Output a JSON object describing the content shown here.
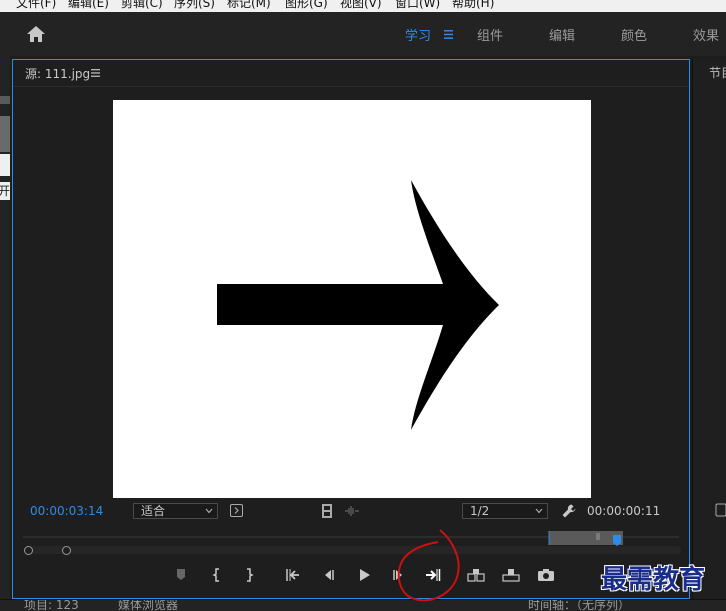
{
  "menu": [
    "文件(F)",
    "编辑(E)",
    "剪辑(C)",
    "序列(S)",
    "标记(M)",
    "图形(G)",
    "视图(V)",
    "窗口(W)",
    "帮助(H)"
  ],
  "workspaces": {
    "learn": "学习",
    "assembly": "组件",
    "editing": "编辑",
    "color": "颜色",
    "effects": "效果"
  },
  "left_strip_text": "开",
  "source_panel": {
    "title": "源: 111.jpg",
    "current_time": "00:00:03:14",
    "zoom": "适合",
    "resolution": "1/2",
    "duration": "00:00:00:11"
  },
  "right_panel": {
    "title": "节目"
  },
  "bottom_tabs": {
    "project": "项目: 123",
    "media_browser": "媒体浏览器",
    "timeline": "时间轴：（无序列）"
  },
  "watermark": "最需教育",
  "colors": {
    "accent": "#2d8ceb",
    "annotation": "#cc1111"
  },
  "icons": [
    "home-icon",
    "hamburger-icon",
    "add-marker-icon",
    "mark-in-icon",
    "mark-out-icon",
    "go-to-in-icon",
    "step-back-icon",
    "play-icon",
    "step-forward-icon",
    "go-to-out-icon",
    "insert-icon",
    "overwrite-icon",
    "export-frame-icon",
    "wrench-icon",
    "drag-video-icon",
    "drag-audio-icon"
  ]
}
